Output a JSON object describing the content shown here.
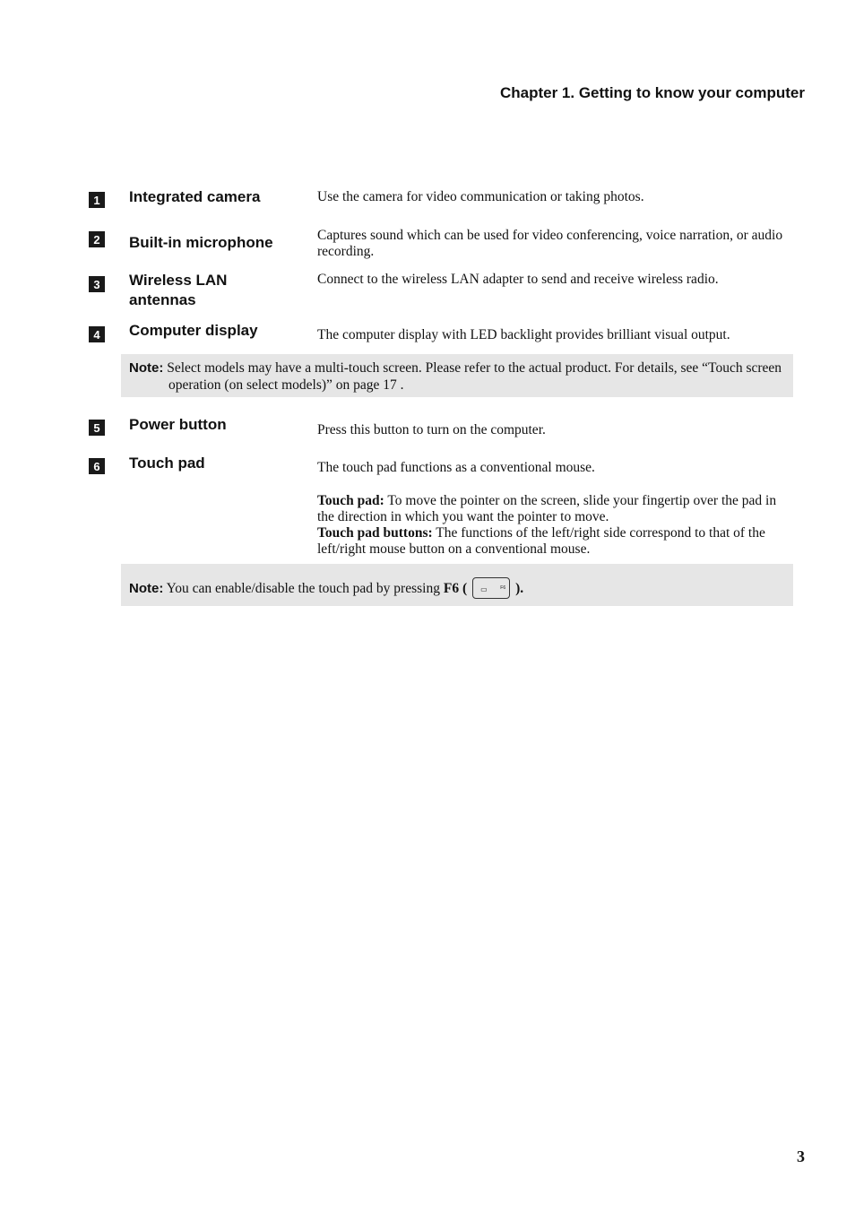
{
  "header": {
    "chapter_title": "Chapter 1. Getting to know your computer"
  },
  "items": [
    {
      "number": "1",
      "term": "Integrated camera",
      "description": "Use the camera for video communication or taking photos."
    },
    {
      "number": "2",
      "term": "Built-in microphone",
      "description": "Captures sound which can be used for video conferencing, voice narration, or audio recording."
    },
    {
      "number": "3",
      "term": "Wireless LAN antennas",
      "description": "Connect to the wireless LAN adapter to send and receive wireless radio."
    },
    {
      "number": "4",
      "term": "Computer display",
      "description": "The computer display with LED backlight provides brilliant visual output."
    },
    {
      "number": "5",
      "term": "Power button",
      "description": "Press this button to turn on the computer."
    },
    {
      "number": "6",
      "term": "Touch pad",
      "description": "The touch pad functions as a conventional mouse."
    }
  ],
  "touchpad_details": [
    {
      "label": "Touch pad:",
      "text": " To move the pointer on the screen, slide your fingertip over the pad in the direction in which you want the pointer to move."
    },
    {
      "label": "Touch pad buttons:",
      "text": " The functions of the left/right side correspond to that of the left/right mouse button on a conventional mouse."
    }
  ],
  "notes": [
    {
      "label": "Note:",
      "text": " Select models may have a multi-touch screen. Please refer to the actual product. For details, see “Touch screen operation (on select models)” on page 17 ."
    },
    {
      "label": "Note:",
      "text": " You can enable/disable the touch pad by pressing ",
      "key": "F6",
      "key_open": " (",
      "key_close": ").",
      "key_icon": "touchpad-toggle-icon",
      "key_cap_label": "F6"
    }
  ],
  "footer": {
    "page_number": "3"
  }
}
